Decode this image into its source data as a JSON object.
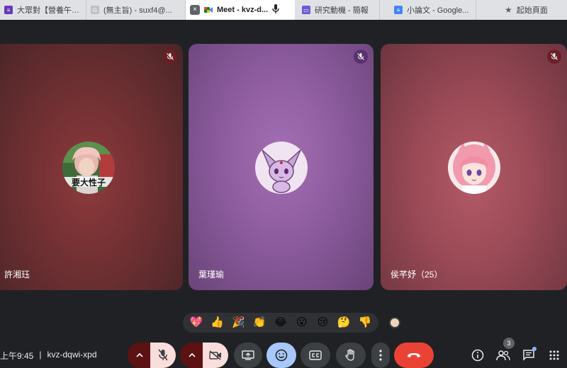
{
  "browser": {
    "tabs": [
      {
        "title": "大眾對【營養午餐種...",
        "icon": "forms-icon",
        "color": "#673ab7"
      },
      {
        "title": "(無主旨) - suxf4@...",
        "icon": "gmail-icon",
        "color": "#9aa0a6"
      },
      {
        "title": "Meet - kvz-d...",
        "icon": "meet-icon",
        "color": "#00832d",
        "active": true
      },
      {
        "title": "研究動機 - 簡報",
        "icon": "slides-icon",
        "color": "#6b5bd6"
      },
      {
        "title": "小論文 - Google...",
        "icon": "docs-icon",
        "color": "#4285f4"
      },
      {
        "title": "起始頁面",
        "icon": "star-icon",
        "color": "#5f6368"
      }
    ]
  },
  "participants": [
    {
      "name": "許湘珏",
      "avatar": "person-avatar",
      "caption": "要大性子",
      "muted": true
    },
    {
      "name": "葉瑾瑜",
      "avatar": "espeon-avatar",
      "muted": true
    },
    {
      "name": "侯芊妤（25）",
      "avatar": "anime-girl-avatar",
      "muted": true
    }
  ],
  "reactions": [
    "💖",
    "👍",
    "🎉",
    "👏",
    "😂",
    "😮",
    "😢",
    "🤔",
    "👎"
  ],
  "meeting": {
    "time": "上午9:45",
    "separator": "|",
    "code": "kvz-dqwi-xpd"
  },
  "people_count": "3",
  "colors": {
    "end_call": "#ea4335",
    "mic_off_bg": "#f9dedc",
    "active_control": "#a8c7fa"
  }
}
